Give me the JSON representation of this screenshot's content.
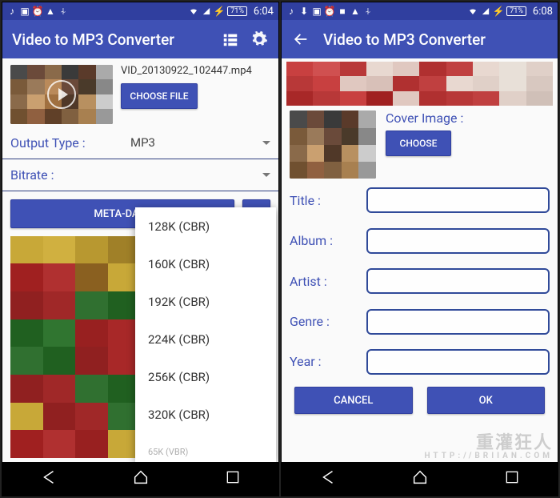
{
  "left": {
    "status": {
      "battery": "71%",
      "time": "6:04"
    },
    "toolbar": {
      "title": "Video to MP3 Converter"
    },
    "file": {
      "name": "VID_20130922_102447.mp4",
      "choose": "CHOOSE FILE"
    },
    "output": {
      "label": "Output Type :",
      "value": "MP3"
    },
    "bitrate": {
      "label": "Bitrate :"
    },
    "buttons": {
      "metadata": "META-DATA"
    },
    "dropdown": {
      "options": [
        "128K (CBR)",
        "160K (CBR)",
        "192K (CBR)",
        "224K (CBR)",
        "256K (CBR)",
        "320K (CBR)",
        "65K (VBR)"
      ]
    }
  },
  "right": {
    "status": {
      "battery": "71%",
      "time": "6:08"
    },
    "toolbar": {
      "title": "Video to MP3 Converter"
    },
    "cover": {
      "label": "Cover Image :",
      "choose": "CHOOSE"
    },
    "fields": {
      "title": "Title :",
      "album": "Album :",
      "artist": "Artist :",
      "genre": "Genre :",
      "year": "Year :"
    },
    "dialog": {
      "cancel": "CANCEL",
      "ok": "OK"
    }
  },
  "watermark": {
    "main": "重灌狂人",
    "sub": "HTTP://BRIIAN.COM"
  }
}
